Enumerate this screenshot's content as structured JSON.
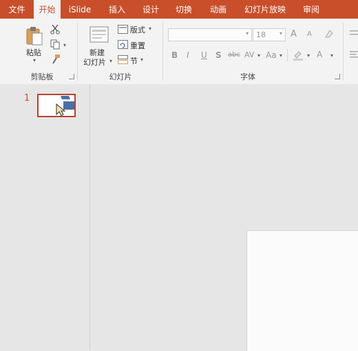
{
  "tabs": [
    "文件",
    "开始",
    "iSlide",
    "插入",
    "设计",
    "切换",
    "动画",
    "幻灯片放映",
    "审阅"
  ],
  "active_tab": "开始",
  "clipboard": {
    "paste_label": "粘贴",
    "group_label": "剪贴板"
  },
  "slides_group": {
    "new_slide_line1": "新建",
    "new_slide_line2": "幻灯片",
    "layout_label": "版式",
    "reset_label": "重置",
    "section_label": "节",
    "group_label": "幻灯片"
  },
  "font_group": {
    "font_size": "18",
    "grow_label": "A",
    "shrink_label": "A",
    "bold": "B",
    "italic": "I",
    "underline": "U",
    "shadow": "S",
    "strike": "abc",
    "spacing": "AV",
    "case": "Aa",
    "font_color": "A",
    "group_label": "字体"
  },
  "thumbnail": {
    "slide_number": "1"
  },
  "colors": {
    "accent": "#c84f2a",
    "thumb_border": "#b5432a",
    "shape_blue": "#4a6fa5"
  }
}
